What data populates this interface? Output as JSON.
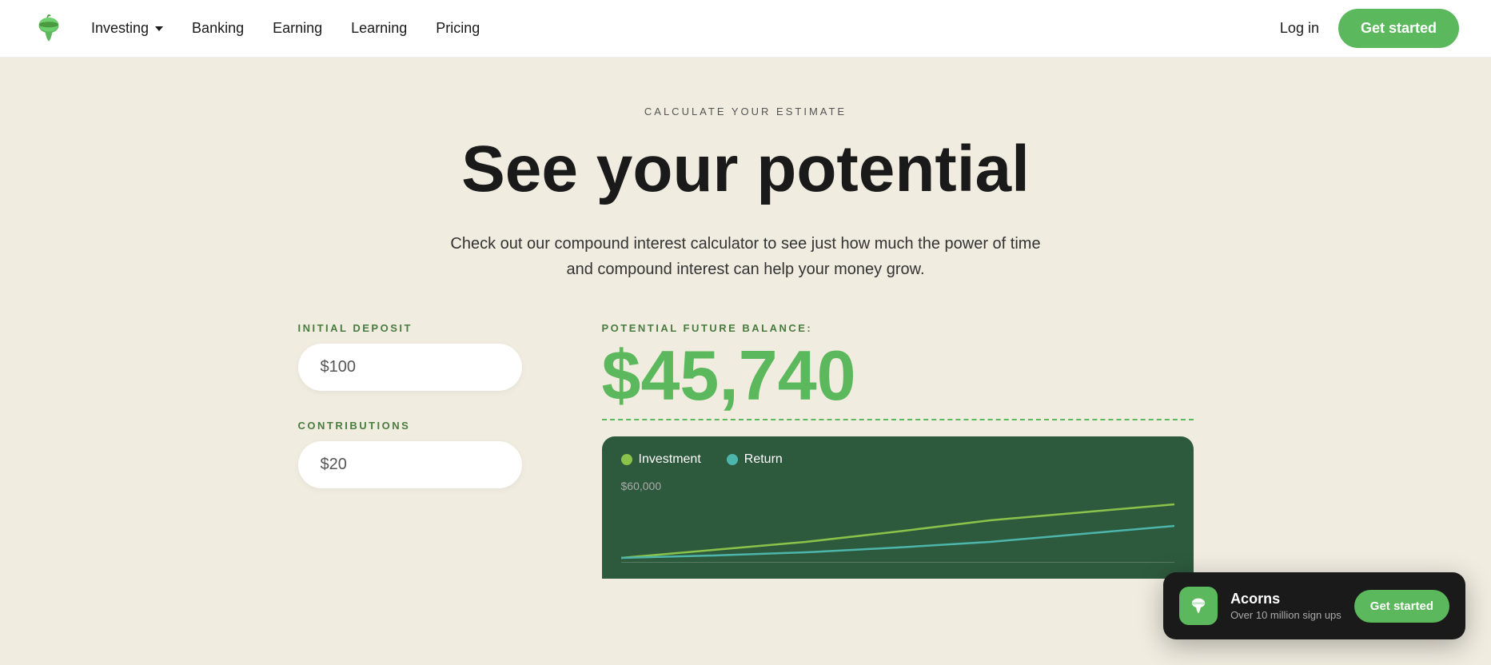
{
  "navbar": {
    "logo_alt": "Acorns",
    "links": [
      {
        "label": "Investing",
        "has_dropdown": true
      },
      {
        "label": "Banking",
        "has_dropdown": false
      },
      {
        "label": "Earning",
        "has_dropdown": false
      },
      {
        "label": "Learning",
        "has_dropdown": false
      },
      {
        "label": "Pricing",
        "has_dropdown": false
      }
    ],
    "login_label": "Log in",
    "get_started_label": "Get started"
  },
  "hero": {
    "calculate_label": "CALCULATE YOUR ESTIMATE",
    "title": "See your potential",
    "description": "Check out our compound interest calculator to see just how much the power of time and compound interest can help your money grow."
  },
  "calculator": {
    "initial_deposit_label": "INITIAL DEPOSIT",
    "initial_deposit_value": "$100",
    "contributions_label": "CONTRIBUTIONS",
    "contributions_value": "$20",
    "potential_label": "POTENTIAL FUTURE BALANCE:",
    "potential_amount": "$45,740",
    "chart": {
      "legend": [
        {
          "label": "Investment",
          "color_class": "dot-investment"
        },
        {
          "label": "Return",
          "color_class": "dot-return"
        }
      ],
      "y_label": "$60,000"
    }
  },
  "toast": {
    "app_name": "Acorns",
    "subtitle": "Over 10 million sign ups",
    "cta_label": "Get started"
  }
}
